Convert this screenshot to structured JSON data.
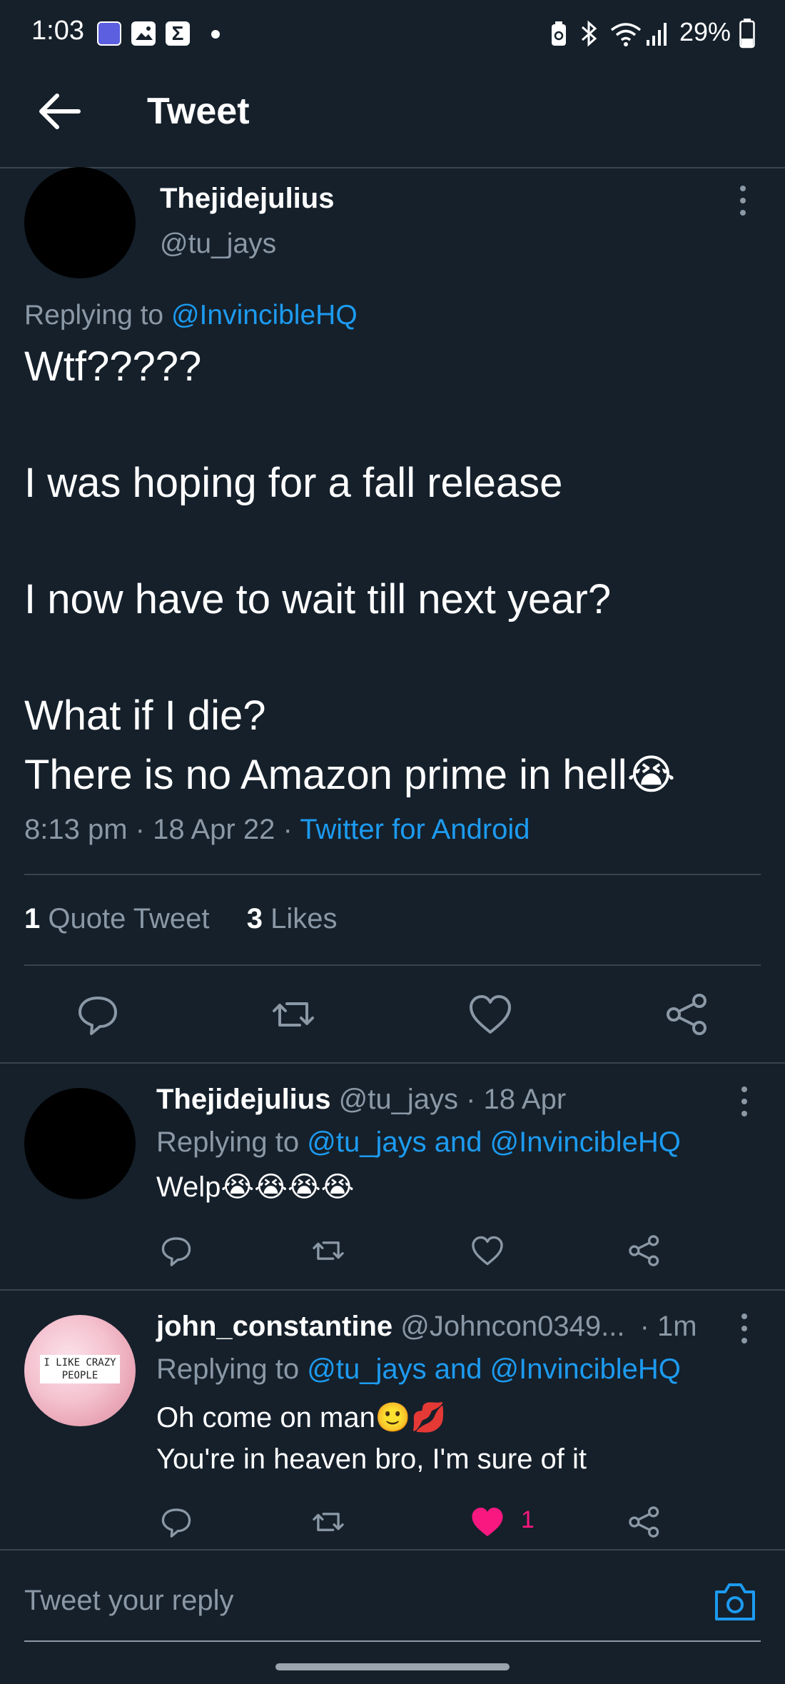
{
  "status_bar": {
    "time": "1:03",
    "battery": "29%",
    "icons": [
      "app-notification-icon",
      "gallery-icon",
      "sigma-icon",
      "dot-icon",
      "battery-saver-icon",
      "bluetooth-icon",
      "wifi-icon",
      "signal-icon",
      "battery-icon"
    ]
  },
  "header": {
    "title": "Tweet",
    "back_icon": "back-arrow-icon"
  },
  "main_tweet": {
    "name": "Thejidejulius",
    "handle": "@tu_jays",
    "replying_prefix": "Replying to",
    "replying_to": "@InvincibleHQ",
    "lines": [
      "Wtf?????",
      "I was hoping for a fall release",
      "I now have to wait till next year?",
      "What if I die?",
      "There is no Amazon prime in hell😭"
    ],
    "time": "8:13 pm",
    "date": "18 Apr 22",
    "source": "Twitter for Android",
    "quote_count": "1",
    "quote_label": "Quote Tweet",
    "likes_count": "3",
    "likes_label": "Likes"
  },
  "replies": [
    {
      "name": "Thejidejulius",
      "handle": "@tu_jays",
      "time": "· 18 Apr",
      "replying_prefix": "Replying to",
      "replying_to": "@tu_jays and @InvincibleHQ",
      "lines": [
        "Welp😭😭😭😭"
      ],
      "like_count": ""
    },
    {
      "name": "john_constantine",
      "handle": "@Johncon0349...",
      "time": "· 1m",
      "replying_prefix": "Replying to",
      "replying_to": "@tu_jays and @InvincibleHQ",
      "lines": [
        "Oh come on man🙂💋",
        "You're in heaven bro, I'm sure of it"
      ],
      "like_count": "1",
      "avatar_text": "I LIKE CRAZY PEOPLE"
    }
  ],
  "composer": {
    "placeholder": "Tweet your reply"
  },
  "colors": {
    "background": "#15202b",
    "accent": "#1d9bf0",
    "muted": "#8b98a5",
    "like": "#f91880",
    "divider": "#38444d"
  }
}
